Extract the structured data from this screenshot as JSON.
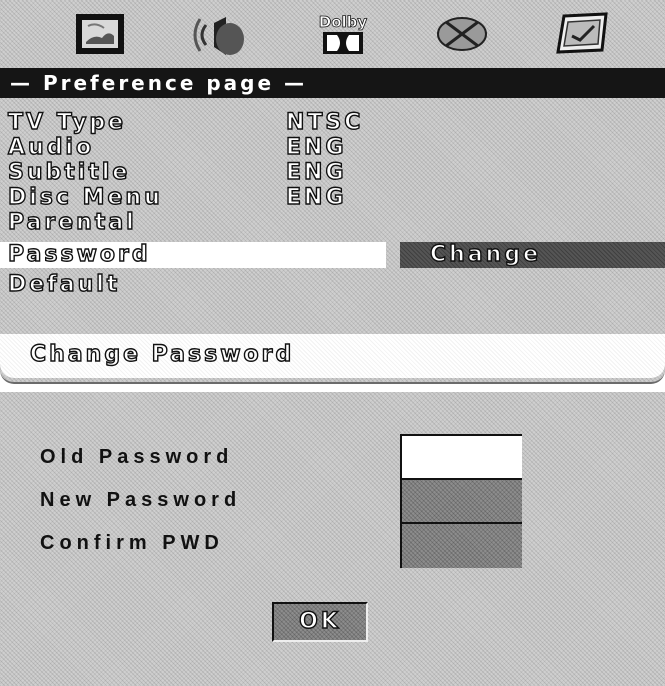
{
  "tabs": [
    {
      "name": "general-setup",
      "icon": "tv-screen-icon"
    },
    {
      "name": "audio-setup",
      "icon": "speaker-icon"
    },
    {
      "name": "dolby-setup",
      "icon": "dolby-digital-icon",
      "label": "Dolby"
    },
    {
      "name": "video-setup",
      "icon": "disc-crossed-icon"
    },
    {
      "name": "preference-setup",
      "icon": "preference-picture-icon"
    }
  ],
  "page_title": "— Preference page —",
  "menu": {
    "rows": [
      {
        "label": "TV Type",
        "value": "NTSC"
      },
      {
        "label": "Audio",
        "value": "ENG"
      },
      {
        "label": "Subtitle",
        "value": "ENG"
      },
      {
        "label": "Disc Menu",
        "value": "ENG"
      },
      {
        "label": "Parental",
        "value": ""
      },
      {
        "label": "Password",
        "value": ""
      },
      {
        "label": "Default",
        "value": ""
      }
    ],
    "selected_option": "Change"
  },
  "status_text": "Change Password",
  "dialog": {
    "old_label": "Old Password",
    "new_label": "New Password",
    "confirm_label": "Confirm PWD",
    "ok_label": "OK"
  }
}
